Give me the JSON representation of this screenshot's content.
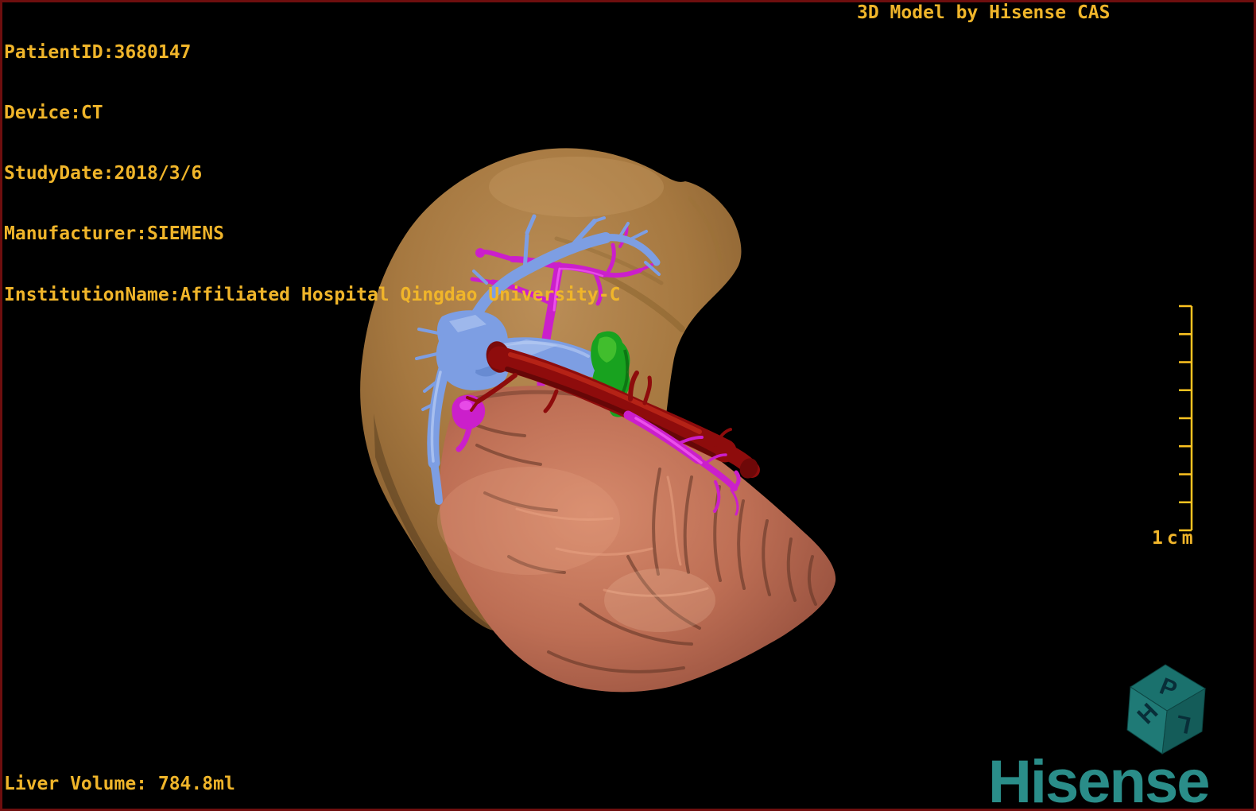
{
  "overlay": {
    "patient_info": [
      "PatientID:3680147",
      "Device:CT",
      "StudyDate:2018/3/6",
      "Manufacturer:SIEMENS",
      "InstitutionName:Affiliated Hospital Qingdao University-C"
    ],
    "watermark": "3D Model by Hisense CAS",
    "liver_volume": "Liver Volume: 784.8ml",
    "text_color": "#f0b52a"
  },
  "scale_bar": {
    "label": "1cm",
    "tick_count": 9,
    "color": "#fdc321"
  },
  "orientation_cube": {
    "letters": {
      "top": "P",
      "left": "H",
      "right": "L"
    },
    "face_colors": {
      "top": "#1a716d",
      "left": "#1f7a76",
      "right": "#145c59"
    },
    "letter_color": "#082e38"
  },
  "logo": {
    "text": "Hisense",
    "color": "#2a8d89"
  },
  "model": {
    "description": "3D liver model",
    "colors": {
      "background": "#000000",
      "border": "#6e0e0e",
      "liver": "#ab7c42",
      "liver_highlight": "#c89e66",
      "liver_shadow": "#6f4c20",
      "stomach": "#bd6e54",
      "stomach_highlight": "#e8a384",
      "stomach_shadow": "#5e3122",
      "portal_vein": "#7d9ee3",
      "portal_vein_highlight": "#b9cdf4",
      "hepatic_artery": "#8e0c0c",
      "hepatic_artery_highlight": "#c22a1a",
      "splenic_vessel": "#cb1fcb",
      "splenic_vessel_highlight": "#f25df2",
      "tumor": "#18a21f",
      "tumor_highlight": "#46c12f"
    }
  }
}
